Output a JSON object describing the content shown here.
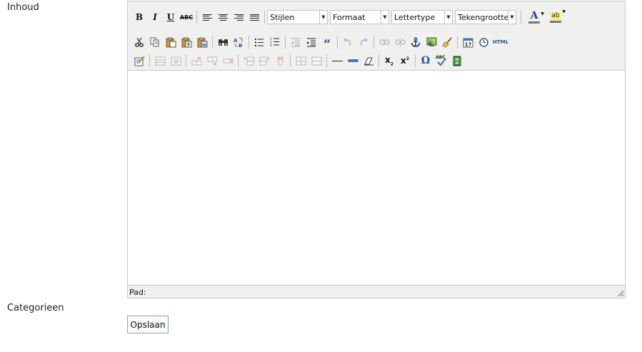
{
  "form": {
    "content_label": "Inhoud",
    "categories_label": "Categorieen",
    "save_label": "Opslaan"
  },
  "editor": {
    "toolbar": {
      "bold": "B",
      "italic": "I",
      "underline": "U",
      "strikethrough": "ABC",
      "styles": "Stijlen",
      "format": "Formaat",
      "font": "Lettertype",
      "font_size": "Tekengrootte",
      "text_color_letter": "A",
      "highlight_letters": "ab",
      "html_label": "HTML",
      "spellcheck_letters": "ABC",
      "subscript": "x",
      "superscript": "x",
      "omega": "Ω"
    },
    "status_path_label": "Pad:"
  },
  "colors": {
    "toolbar_bg": "#f0f0ee",
    "border": "#c9c9c9",
    "button_border": "#8ca4bd"
  }
}
